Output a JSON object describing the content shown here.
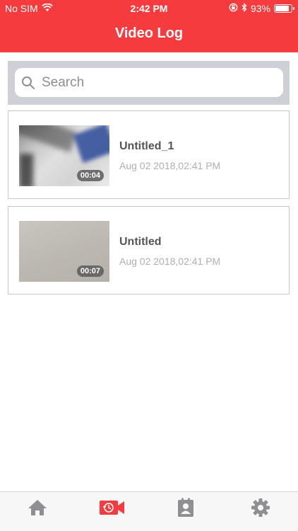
{
  "status_bar": {
    "carrier": "No SIM",
    "time": "2:42 PM",
    "battery": "93%",
    "battery_level": 0.93
  },
  "header": {
    "title": "Video Log"
  },
  "search": {
    "placeholder": "Search"
  },
  "videos": [
    {
      "title": "Untitled_1",
      "date": "Aug 02 2018,02:41 PM",
      "duration": "00:04"
    },
    {
      "title": "Untitled",
      "date": "Aug 02 2018,02:41 PM",
      "duration": "00:07"
    }
  ],
  "tabs": [
    {
      "icon": "home-icon",
      "active": false
    },
    {
      "icon": "video-history-icon",
      "active": true
    },
    {
      "icon": "contacts-icon",
      "active": false
    },
    {
      "icon": "settings-icon",
      "active": false
    }
  ],
  "colors": {
    "accent": "#f63b3e",
    "tab_inactive": "#8e8e93"
  }
}
